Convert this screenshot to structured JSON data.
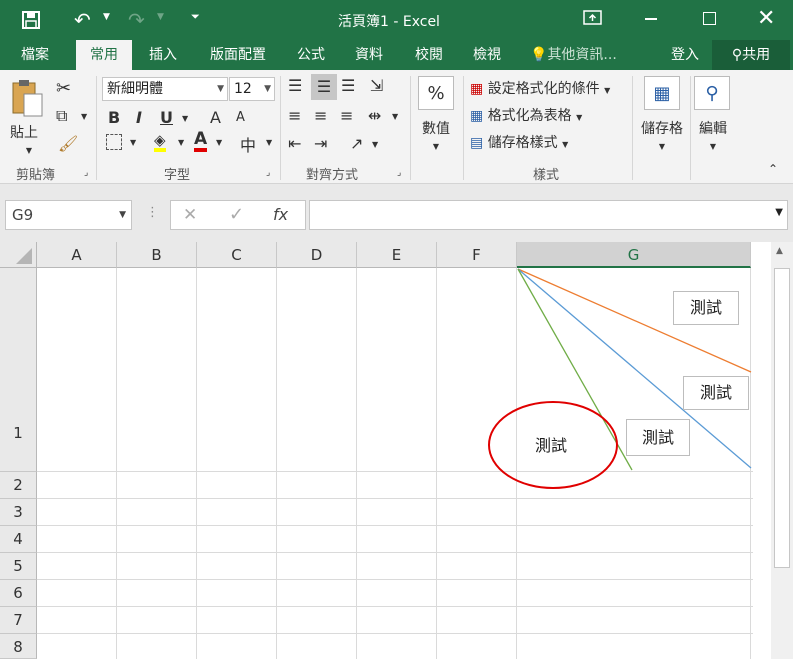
{
  "title": {
    "text": "活頁簿1 - Excel"
  },
  "tabs": {
    "file": "檔案",
    "home": "常用",
    "insert": "插入",
    "layout": "版面配置",
    "formulas": "公式",
    "data": "資料",
    "review": "校閱",
    "view": "檢視",
    "tellme": "其他資訊...",
    "signin": "登入",
    "share": "共用"
  },
  "ribbon": {
    "paste": "貼上",
    "clipboard": "剪貼簿",
    "font_name": "新細明體",
    "font_size": "12",
    "font_group": "字型",
    "align_group": "對齊方式",
    "number_label": "數值",
    "number_symbol": "%",
    "cond_format": "設定格式化的條件",
    "format_table": "格式化為表格",
    "cell_styles": "儲存格樣式",
    "styles_group": "樣式",
    "cells": "儲存格",
    "editing": "編輯",
    "bold": "B",
    "italic": "I",
    "underline": "U",
    "grow": "A",
    "shrink": "A",
    "phonetic": "中"
  },
  "formula_bar": {
    "namebox": "G9",
    "fx": "fx",
    "formula": ""
  },
  "sheet": {
    "columns": [
      "A",
      "B",
      "C",
      "D",
      "E",
      "F",
      "G"
    ],
    "rows": [
      "1",
      "2",
      "3",
      "4",
      "5",
      "6",
      "7",
      "8"
    ],
    "selected_column": "G"
  },
  "shapes": {
    "textbox1": "測試",
    "textbox2": "測試",
    "textbox3": "測試",
    "oval_text": "測試",
    "line_colors": {
      "orange": "#ed7d31",
      "blue": "#5b9bd5",
      "green": "#70ad47"
    },
    "oval_color": "#e00000"
  },
  "colors": {
    "accent": "#217346"
  }
}
